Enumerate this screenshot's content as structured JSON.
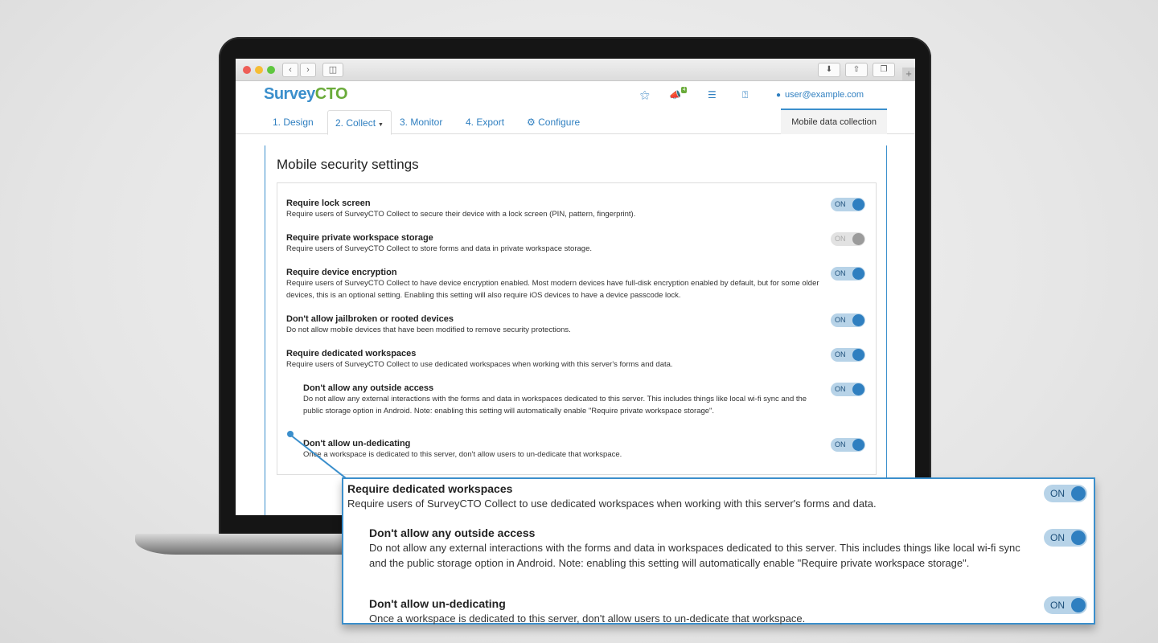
{
  "app": {
    "logo_part1": "Sur",
    "logo_part2": "vey",
    "logo_part3": "CTO",
    "user": "user@example.com",
    "notification_count": "4"
  },
  "tabs": [
    {
      "label": "1. Design"
    },
    {
      "label": "2. Collect"
    },
    {
      "label": "3. Monitor"
    },
    {
      "label": "4. Export"
    },
    {
      "label": "Configure"
    }
  ],
  "active_tab": "2. Collect",
  "right_tab": "Mobile data collection",
  "page_title": "Mobile security settings",
  "settings": [
    {
      "title": "Require lock screen",
      "desc": "Require users of SurveyCTO Collect to secure their device with a lock screen (PIN, pattern, fingerprint).",
      "toggle": "ON",
      "enabled": true
    },
    {
      "title": "Require private workspace storage",
      "desc": "Require users of SurveyCTO Collect to store forms and data in private workspace storage.",
      "toggle": "ON",
      "enabled": false
    },
    {
      "title": "Require device encryption",
      "desc": "Require users of SurveyCTO Collect to have device encryption enabled. Most modern devices have full-disk encryption enabled by default, but for some older devices, this is an optional setting. Enabling this setting will also require iOS devices to have a device passcode lock.",
      "toggle": "ON",
      "enabled": true
    },
    {
      "title": "Don't allow jailbroken or rooted devices",
      "desc": "Do not allow mobile devices that have been modified to remove security protections.",
      "toggle": "ON",
      "enabled": true
    },
    {
      "title": "Require dedicated workspaces",
      "desc": "Require users of SurveyCTO Collect to use dedicated workspaces when working with this server's forms and data.",
      "toggle": "ON",
      "enabled": true
    },
    {
      "title": "Don't allow any outside access",
      "desc": "Do not allow any external interactions with the forms and data in workspaces dedicated to this server. This includes things like local wi-fi sync and the public storage option in Android. Note: enabling this setting will automatically enable \"Require private workspace storage\".",
      "toggle": "ON",
      "enabled": true
    },
    {
      "title": "Don't allow un-dedicating",
      "desc": "Once a workspace is dedicated to this server, don't allow users to un-dedicate that workspace.",
      "toggle": "ON",
      "enabled": true
    }
  ],
  "callout": [
    {
      "title": "Require dedicated workspaces",
      "desc": "Require users of SurveyCTO Collect to use dedicated workspaces when working with this server's forms and data.",
      "toggle": "ON"
    },
    {
      "title": "Don't allow any outside access",
      "desc": "Do not allow any external interactions with the forms and data in workspaces dedicated to this server. This includes things like local wi-fi sync and the public storage option in Android. Note: enabling this setting will automatically enable \"Require private workspace storage\".",
      "toggle": "ON"
    },
    {
      "title": "Don't allow un-dedicating",
      "desc": "Once a workspace is dedicated to this server, don't allow users to un-dedicate that workspace.",
      "toggle": "ON"
    }
  ],
  "colors": {
    "accent": "#3b8fcc",
    "logo_green": "#6aab3a"
  },
  "icons": [
    "stethoscope-icon",
    "megaphone-icon",
    "server-icon",
    "help-icon",
    "user-icon",
    "gear-icon",
    "download-icon",
    "share-icon",
    "tabs-icon",
    "sidebar-icon",
    "back-icon",
    "forward-icon"
  ]
}
